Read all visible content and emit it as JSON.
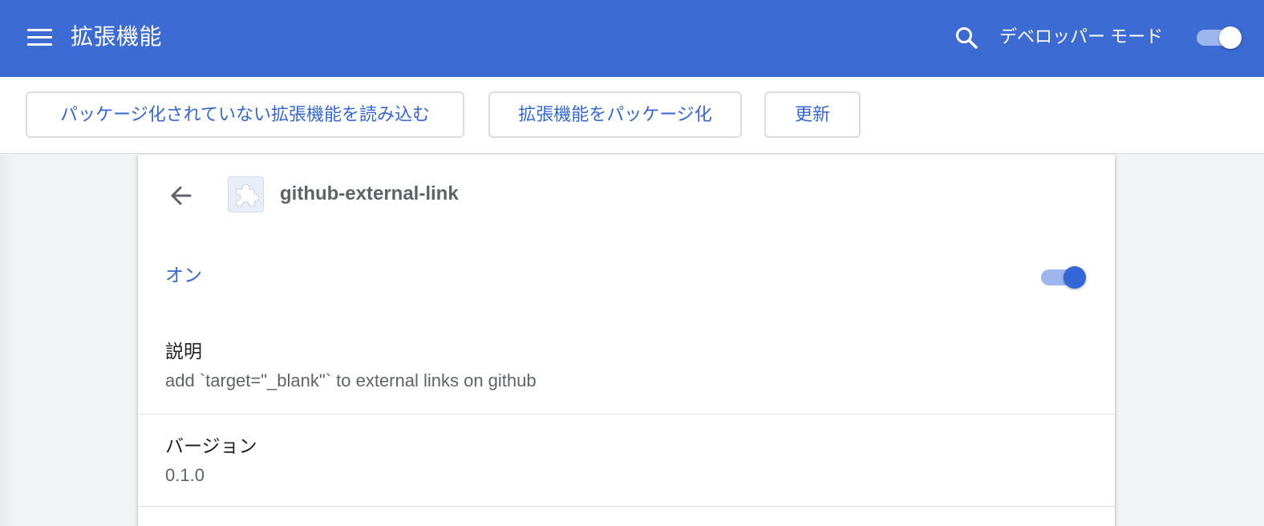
{
  "header": {
    "title": "拡張機能",
    "developer_mode_label": "デベロッパー モード",
    "developer_mode_on": true
  },
  "toolbar": {
    "load_unpacked_label": "パッケージ化されていない拡張機能を読み込む",
    "pack_extension_label": "拡張機能をパッケージ化",
    "update_label": "更新"
  },
  "extension": {
    "name": "github-external-link",
    "status_label": "オン",
    "enabled": true,
    "description_label": "説明",
    "description": "add `target=\"_blank\"` to external links on github",
    "version_label": "バージョン",
    "version": "0.1.0"
  },
  "colors": {
    "header_bg": "#3c6bd3",
    "accent": "#3367d6",
    "toggle_track": "#9db7ee"
  }
}
